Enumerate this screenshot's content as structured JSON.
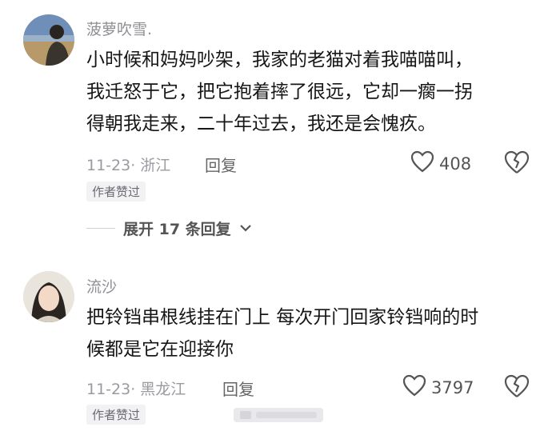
{
  "comments": [
    {
      "username": "菠萝吹雪.",
      "lines": [
        "小时候和妈妈吵架，我家的老猫对着我喵喵叫，",
        "我迁怒于它，把它抱着摔了很远，它却一瘸一拐",
        "得朝我走来，二十年过去，我还是会愧疚。"
      ],
      "date_location": "11-23· 浙江",
      "reply_label": "回复",
      "like_count": "408",
      "badge": "作者赞过",
      "expand_label": "展开 17 条回复"
    },
    {
      "username": "流沙",
      "lines": [
        "把铃铛串根线挂在门上 每次开门回家铃铛响的时",
        "候都是它在迎接你"
      ],
      "date_location": "11-23· 黑龙江",
      "reply_label": "回复",
      "like_count": "3797",
      "badge": "作者赞过"
    }
  ],
  "icons": {
    "like": "heart-outline-icon",
    "dislike": "broken-heart-icon",
    "expand": "chevron-down-icon"
  },
  "colors": {
    "username": "#8e8e93",
    "meta": "#9a9aa0",
    "badge_bg": "#f2f2f4"
  }
}
